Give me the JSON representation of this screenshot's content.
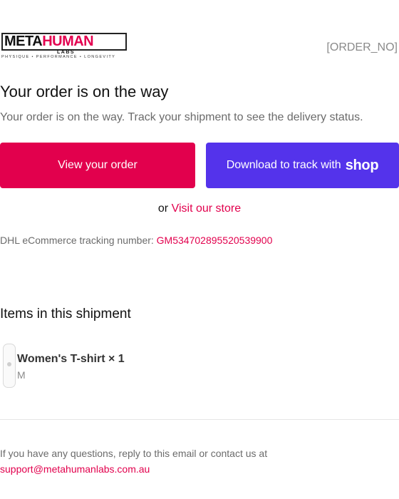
{
  "header": {
    "logo": {
      "word_meta": "META",
      "word_human": "HUMAN",
      "labs": "LABS",
      "tagline": "PHYSIQUE • PERFORMANCE • LONGEVITY"
    },
    "order_number": "[ORDER_NO]"
  },
  "main": {
    "title": "Your order is on the way",
    "subtitle": "Your order is on the way. Track your shipment to see the delivery status.",
    "view_order_label": "View your order",
    "download_track_label": "Download to track with",
    "shop_logo_text": "shop",
    "or_text": "or",
    "visit_store_label": "Visit our store",
    "tracking_label": "DHL eCommerce tracking number:",
    "tracking_number": "GM534702895520539900"
  },
  "shipment": {
    "title": "Items in this shipment",
    "items": [
      {
        "name": "Women's T-shirt × 1",
        "variant": "M"
      }
    ]
  },
  "footer": {
    "text": "If you have any questions, reply to this email or contact us at",
    "email": "support@metahumanlabs.com.au"
  },
  "colors": {
    "accent": "#e2004d",
    "shop_purple": "#5433eb",
    "muted_text": "#6b6b6b"
  }
}
